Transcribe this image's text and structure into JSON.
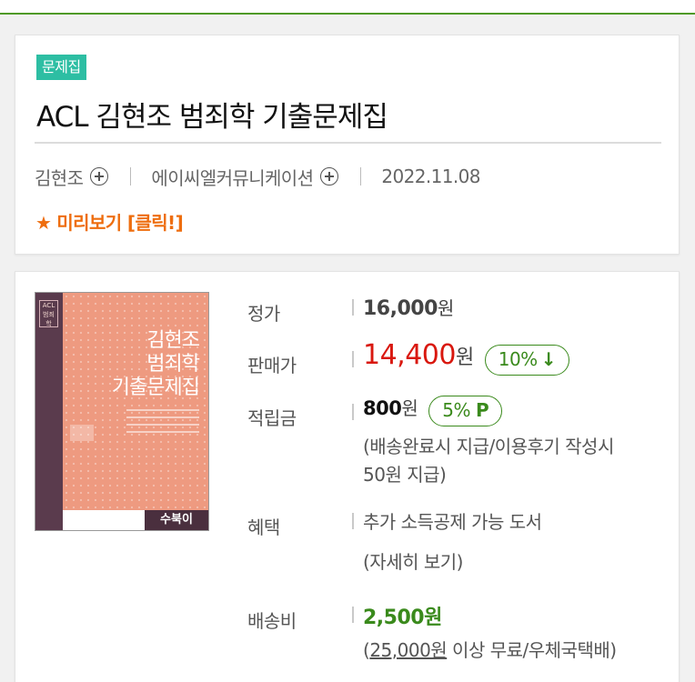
{
  "header": {
    "category_badge": "문제집",
    "title": "ACL 김현조 범죄학 기출문제집",
    "author": "김현조",
    "publisher": "에이씨엘커뮤니케이션",
    "date": "2022.11.08",
    "preview_star": "★",
    "preview_label": "미리보기 [클릭!]"
  },
  "book_cover": {
    "spine_tag": "ACL 범죄학",
    "title_lines": [
      "김현조",
      "범죄학",
      "기출문제집"
    ],
    "brand": "수북이"
  },
  "pricing": {
    "list_price_label": "정가",
    "list_price": "16,000",
    "won": "원",
    "sale_price_label": "판매가",
    "sale_price": "14,400",
    "discount": "10%",
    "discount_icon": "↓",
    "points_label": "적립금",
    "points": "800",
    "points_rate": "5%",
    "points_icon": "P",
    "points_note_1": "(배송완료시 지급/이용후기 작성시",
    "points_note_2": "50원 지급)",
    "benefit_label": "혜택",
    "benefit_text": "추가 소득공제 가능 도서",
    "benefit_link": "(자세히 보기)",
    "shipping_label": "배송비",
    "shipping_fee": "2,500원",
    "shipping_note_open": "(",
    "shipping_threshold": "25,000원",
    "shipping_note_rest": " 이상 무료/우체국택배)"
  },
  "colors": {
    "badge": "#2dbea3",
    "sale_price": "#d9180f",
    "accent_green": "#3a8a1c",
    "preview_orange": "#ee6d0e",
    "top_line": "#4e9a28"
  }
}
